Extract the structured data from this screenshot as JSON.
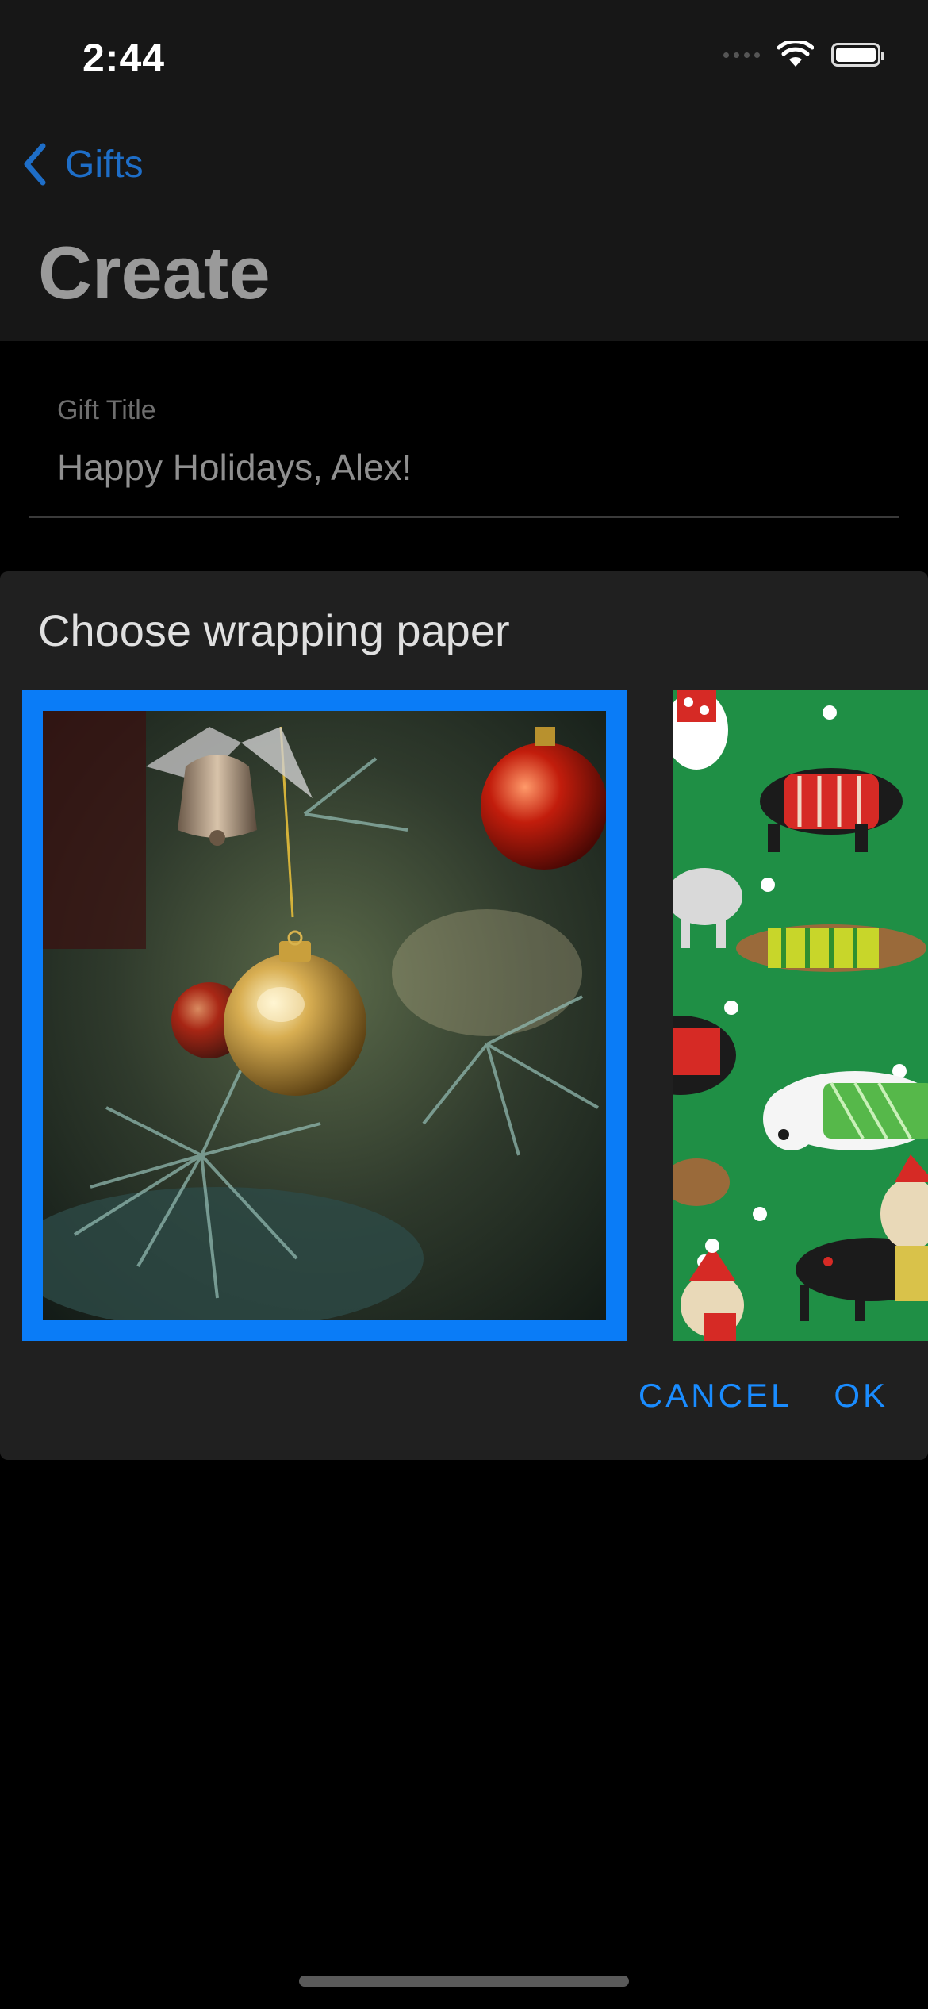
{
  "status": {
    "time": "2:44"
  },
  "nav": {
    "back_label": "Gifts",
    "title": "Create"
  },
  "form": {
    "gift_title_label": "Gift Title",
    "gift_title_value": "Happy Holidays, Alex!"
  },
  "dialog": {
    "title": "Choose wrapping paper",
    "options": [
      {
        "name": "christmas-ornaments",
        "selected": true
      },
      {
        "name": "dogs-in-sweaters",
        "selected": false
      }
    ],
    "cancel_label": "CANCEL",
    "ok_label": "OK"
  },
  "colors": {
    "accent": "#0a7cf7",
    "link": "#1a8cff",
    "dialog_bg": "#202020"
  }
}
